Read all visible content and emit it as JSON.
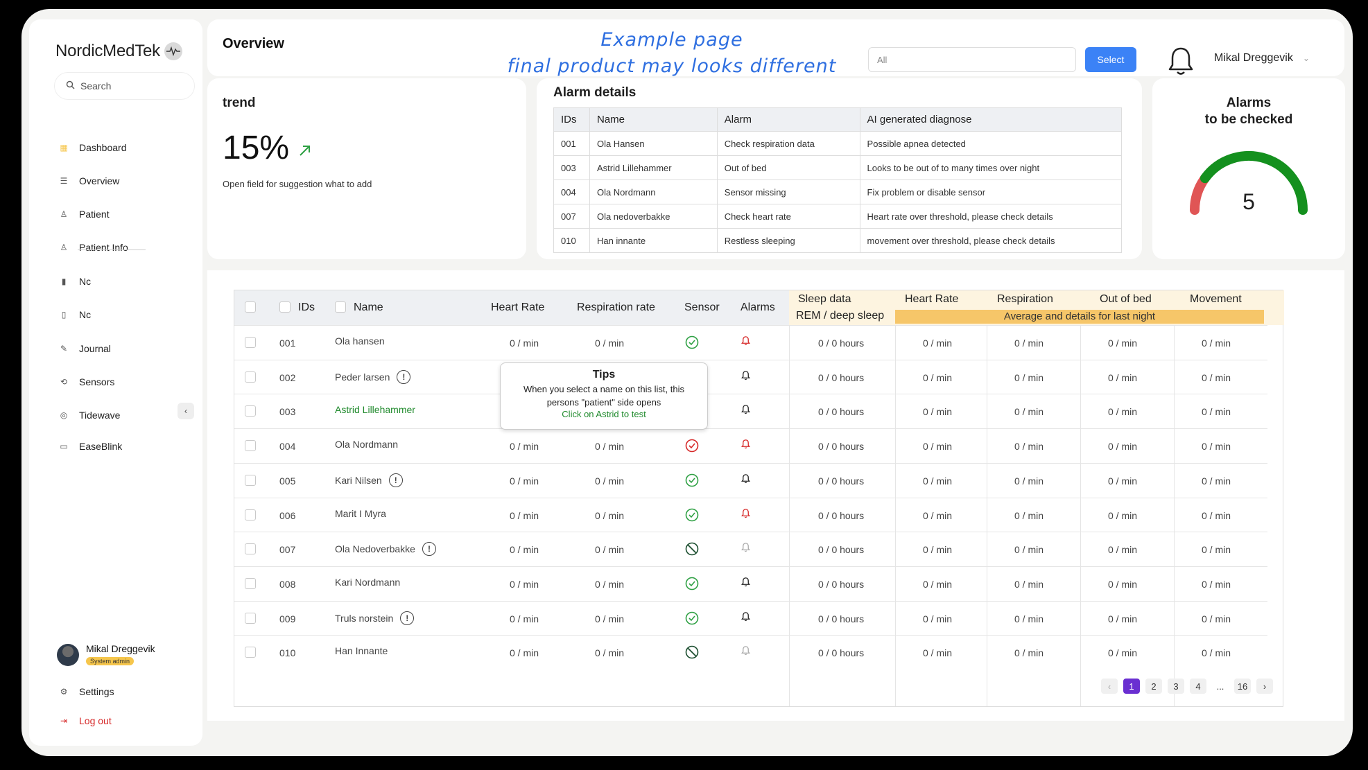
{
  "app": {
    "name": "NordicMedTek"
  },
  "sidebar": {
    "search_placeholder": "Search",
    "items": [
      {
        "label": "Dashboard",
        "icon": "dashboard-icon"
      },
      {
        "label": "Overview",
        "icon": "list-icon"
      },
      {
        "label": "Patient",
        "icon": "user-icon"
      },
      {
        "label": "Patient Info",
        "icon": "users-icon"
      },
      {
        "label": "Nc",
        "icon": "bar-chart-icon"
      },
      {
        "label": "Nc",
        "icon": "clipboard-icon"
      },
      {
        "label": "Journal",
        "icon": "pencil-icon"
      },
      {
        "label": "Sensors",
        "icon": "sensor-icon"
      },
      {
        "label": "Tidewave",
        "icon": "wave-icon"
      },
      {
        "label": "EaseBlink",
        "icon": "cast-icon"
      }
    ],
    "user": {
      "name": "Mikal Dreggevik",
      "role": "System admin"
    },
    "settings_label": "Settings",
    "logout_label": "Log out",
    "accent_color": "#f6c64c",
    "logout_color": "#d62828"
  },
  "header": {
    "title": "Overview",
    "watermark_line1": "Example page",
    "watermark_line2": "final product may looks different",
    "filter_value": "All",
    "select_label": "Select",
    "user_name": "Mikal Dreggevik"
  },
  "trend": {
    "title": "trend",
    "value": "15%",
    "note": "Open field for suggestion what to add"
  },
  "alarm_details": {
    "title": "Alarm details",
    "columns": [
      "IDs",
      "Name",
      "Alarm",
      "AI generated diagnose"
    ],
    "rows": [
      [
        "001",
        "Ola Hansen",
        "Check respiration data",
        "Possible apnea detected"
      ],
      [
        "003",
        "Astrid Lillehammer",
        "Out of bed",
        "Looks to be out of to many times over night"
      ],
      [
        "004",
        "Ola Nordmann",
        "Sensor missing",
        "Fix problem or disable sensor"
      ],
      [
        "007",
        "Ola nedoverbakke",
        "Check heart rate",
        "Heart rate over threshold, please check details"
      ],
      [
        "010",
        "Han innante",
        "Restless sleeping",
        "movement over threshold, please check details"
      ]
    ]
  },
  "gauge": {
    "title_line1": "Alarms",
    "title_line2": "to be checked",
    "value": "5",
    "fraction": 0.2
  },
  "table": {
    "headers": {
      "ids": "IDs",
      "name": "Name",
      "heart_rate": "Heart Rate",
      "resp_rate": "Respiration rate",
      "sensor": "Sensor",
      "alarms": "Alarms",
      "sleep_line1": "Sleep data",
      "sleep_line2": "REM / deep sleep",
      "night_heart": "Heart Rate",
      "night_resp": "Respiration",
      "night_out": "Out of bed",
      "night_move": "Movement",
      "band": "Average and details for last night"
    },
    "rows": [
      {
        "id": "001",
        "name": "Ola hansen",
        "warn": false,
        "hr": "0 / min",
        "rr": "0 / min",
        "sensor": "ok",
        "alarm": "red",
        "sleep": "0 / 0 hours",
        "nhr": "0 / min",
        "nrr": "0 / min",
        "nout": "0 / min",
        "nmove": "0 / min"
      },
      {
        "id": "002",
        "name": "Peder larsen",
        "warn": true,
        "hr": "",
        "rr": "",
        "sensor": "ok",
        "alarm": "black",
        "sleep": "0 / 0 hours",
        "nhr": "0 / min",
        "nrr": "0 / min",
        "nout": "0 / min",
        "nmove": "0 / min"
      },
      {
        "id": "003",
        "name": "Astrid Lillehammer",
        "warn": false,
        "highlight": true,
        "hr": "",
        "rr": "",
        "sensor": "ok",
        "alarm": "black",
        "sleep": "0 / 0 hours",
        "nhr": "0 / min",
        "nrr": "0 / min",
        "nout": "0 / min",
        "nmove": "0 / min"
      },
      {
        "id": "004",
        "name": "Ola Nordmann",
        "warn": false,
        "hr": "0 / min",
        "rr": "0 / min",
        "sensor": "error",
        "alarm": "red",
        "sleep": "0 / 0 hours",
        "nhr": "0 / min",
        "nrr": "0 / min",
        "nout": "0 / min",
        "nmove": "0 / min"
      },
      {
        "id": "005",
        "name": "Kari Nilsen",
        "warn": true,
        "hr": "0 / min",
        "rr": "0 / min",
        "sensor": "ok",
        "alarm": "black",
        "sleep": "0 / 0 hours",
        "nhr": "0 / min",
        "nrr": "0 / min",
        "nout": "0 / min",
        "nmove": "0 / min"
      },
      {
        "id": "006",
        "name": "Marit I Myra",
        "warn": false,
        "hr": "0 / min",
        "rr": "0 / min",
        "sensor": "ok",
        "alarm": "red",
        "sleep": "0 / 0 hours",
        "nhr": "0 / min",
        "nrr": "0 / min",
        "nout": "0 / min",
        "nmove": "0 / min"
      },
      {
        "id": "007",
        "name": "Ola Nedoverbakke",
        "warn": true,
        "hr": "0 / min",
        "rr": "0 / min",
        "sensor": "disabled",
        "alarm": "grey",
        "sleep": "0 / 0 hours",
        "nhr": "0 / min",
        "nrr": "0 / min",
        "nout": "0 / min",
        "nmove": "0 / min"
      },
      {
        "id": "008",
        "name": "Kari Nordmann",
        "warn": false,
        "hr": "0 / min",
        "rr": "0 / min",
        "sensor": "ok",
        "alarm": "black",
        "sleep": "0 / 0 hours",
        "nhr": "0 / min",
        "nrr": "0 / min",
        "nout": "0 / min",
        "nmove": "0 / min"
      },
      {
        "id": "009",
        "name": "Truls norstein",
        "warn": true,
        "hr": "0 / min",
        "rr": "0 / min",
        "sensor": "ok",
        "alarm": "black",
        "sleep": "0 / 0 hours",
        "nhr": "0 / min",
        "nrr": "0 / min",
        "nout": "0 / min",
        "nmove": "0 / min"
      },
      {
        "id": "010",
        "name": "Han Innante",
        "warn": false,
        "hr": "0 / min",
        "rr": "0 / min",
        "sensor": "disabled",
        "alarm": "grey",
        "sleep": "0 / 0 hours",
        "nhr": "0 / min",
        "nrr": "0 / min",
        "nout": "0 / min",
        "nmove": "0 / min"
      }
    ],
    "tip": {
      "title": "Tips",
      "body": "When you select a name on this list, this persons \"patient\" side opens",
      "link": "Click on Astrid to test"
    },
    "pagination": {
      "pages": [
        "1",
        "2",
        "3",
        "4",
        "...",
        "16"
      ],
      "current": "1"
    },
    "colors": {
      "ok": "#2ea043",
      "error": "#d62828",
      "highlight_name": "#1f8a2c",
      "band": "#f6c669"
    }
  }
}
